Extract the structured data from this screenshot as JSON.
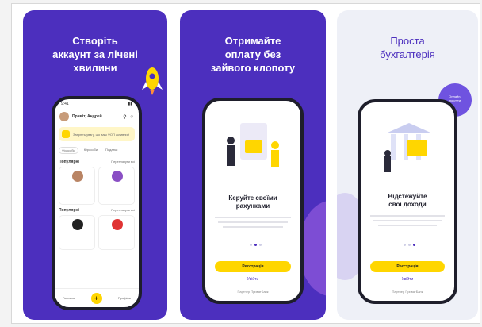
{
  "cards": [
    {
      "title": "Створіть\nаккаунт за лічені\nхвилини",
      "phone": {
        "time": "9:41",
        "greeting": "Привіт, Андрей",
        "banner": "Зверніть увагу, що ваш ФОП активний",
        "tabs": [
          "Фізособи",
          "Юрособи",
          "Податки"
        ],
        "section1": "Популярні",
        "section1_link": "Переглянути всі",
        "section2": "Популярні",
        "section2_link": "Переглянути всі",
        "nav": [
          "Головна",
          "Створити акт",
          "Профіль"
        ]
      }
    },
    {
      "title": "Отримайте\nоплату без\nзайвого клопоту",
      "phone": {
        "heading": "Керуйте своїми\nрахунками",
        "button": "Реєстрація",
        "link": "Увійти",
        "bank": "Партнер ПриватБанк"
      }
    },
    {
      "title": "Проста\nбухгалтерія",
      "badge": "Онлайн-\nпослуги",
      "phone": {
        "heading": "Відстежуйте\nсвої доходи",
        "button": "Реєстрація",
        "link": "Увійти",
        "bank": "Партнер ПриватБанк"
      }
    }
  ],
  "colors": {
    "purple": "#4c2fbe",
    "yellow": "#ffd600",
    "light": "#eef0f7"
  }
}
